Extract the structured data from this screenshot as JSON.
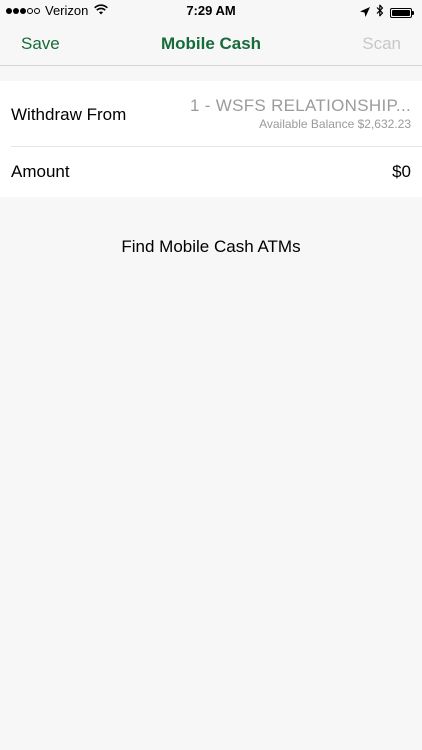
{
  "status_bar": {
    "carrier": "Verizon",
    "time": "7:29 AM",
    "signal_dots_filled": 3,
    "signal_dots_total": 5,
    "icons": [
      "wifi-icon",
      "location-arrow-icon",
      "bluetooth-icon",
      "battery-icon"
    ]
  },
  "nav": {
    "left_label": "Save",
    "title": "Mobile Cash",
    "right_label": "Scan"
  },
  "form": {
    "withdraw": {
      "label": "Withdraw From",
      "account": "1 - WSFS RELATIONSHIP...",
      "balance": "Available Balance $2,632.23"
    },
    "amount": {
      "label": "Amount",
      "value": "$0"
    }
  },
  "find_atms_label": "Find Mobile Cash ATMs",
  "colors": {
    "accent": "#176c3c",
    "disabled": "#c7c7c7",
    "secondary_text": "#9b9b9b",
    "background": "#f7f7f7"
  }
}
